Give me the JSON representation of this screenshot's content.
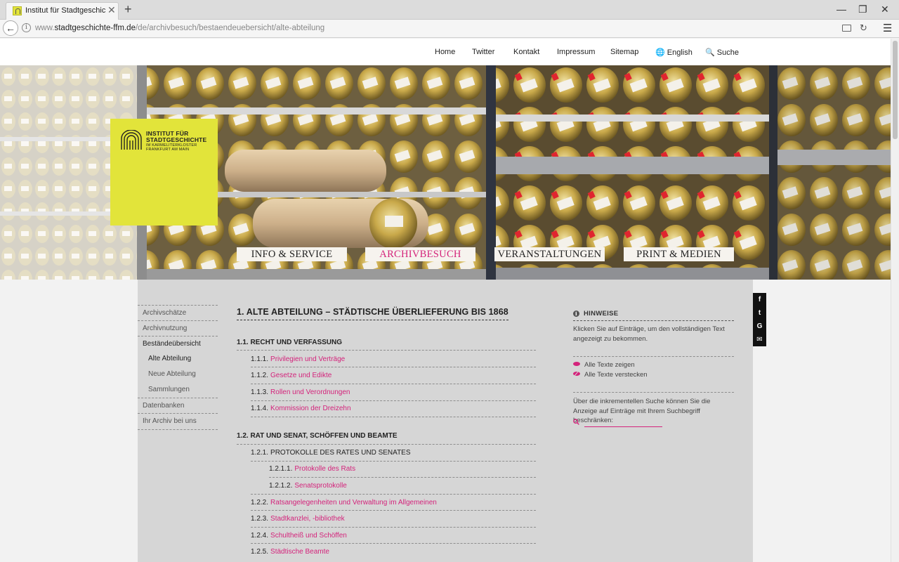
{
  "browser": {
    "tab_title": "Institut für Stadtgeschicht…",
    "tab_close": "✕",
    "new_tab": "+",
    "url_prefix": "www.",
    "url_domain": "stadtgeschichte-ffm.de",
    "url_path": "/de/archivbesuch/bestaendeuebersicht/alte-abteilung",
    "window_controls": [
      "—",
      "❐",
      "✕"
    ],
    "back_glyph": "←",
    "reload_glyph": "↻",
    "menu_glyph": "☰",
    "info_glyph": "i"
  },
  "topnav": {
    "items": [
      "Home",
      "Twitter",
      "Kontakt",
      "Impressum",
      "Sitemap",
      "🌐 English",
      "🔍 Suche"
    ]
  },
  "logo": {
    "line1": "INSTITUT FÜR",
    "line2": "STADTGESCHICHTE",
    "line3": "IM KARMELITERKLOSTER",
    "line4": "FRANKFURT AM MAIN"
  },
  "mainnav": {
    "items": [
      "INFO & SERVICE",
      "ARCHIVBESUCH",
      "VERANSTALTUNGEN",
      "PRINT & MEDIEN"
    ],
    "active_index": 1
  },
  "sidebar": {
    "items": [
      "Archivschätze",
      "Archivnutzung",
      "Beständeübersicht",
      "Alte Abteilung",
      "Neue Abteilung",
      "Sammlungen",
      "Datenbanken",
      "Ihr Archiv bei uns"
    ]
  },
  "main": {
    "title": "1. ALTE ABTEILUNG – STÄDTISCHE ÜBERLIEFERUNG BIS 1868",
    "section1": {
      "heading": "1.1. RECHT UND VERFASSUNG",
      "entries": [
        {
          "num": "1.1.1.",
          "label": "Privilegien und Verträge"
        },
        {
          "num": "1.1.2.",
          "label": "Gesetze und Edikte"
        },
        {
          "num": "1.1.3.",
          "label": "Rollen und Verordnungen"
        },
        {
          "num": "1.1.4.",
          "label": "Kommission der Dreizehn"
        }
      ]
    },
    "section2": {
      "heading": "1.2. RAT UND SENAT, SCHÖFFEN UND BEAMTE",
      "sub_heading_num": "1.2.1.",
      "sub_heading": "PROTOKOLLE DES RATES UND SENATES",
      "sub_entries": [
        {
          "num": "1.2.1.1.",
          "label": "Protokolle des Rats"
        },
        {
          "num": "1.2.1.2.",
          "label": "Senatsprotokolle"
        }
      ],
      "entries": [
        {
          "num": "1.2.2.",
          "label": "Ratsangelegenheiten und Verwaltung im Allgemeinen"
        },
        {
          "num": "1.2.3.",
          "label": "Stadtkanzlei, -bibliothek"
        },
        {
          "num": "1.2.4.",
          "label": "Schultheiß und Schöffen"
        },
        {
          "num": "1.2.5.",
          "label": "Städtische Beamte"
        }
      ]
    }
  },
  "hints": {
    "heading": "HINWEISE",
    "text": "Klicken Sie auf Einträge, um den vollständigen Text angezeigt zu bekommen.",
    "show_all": "Alle Texte zeigen",
    "hide_all": "Alle Texte verstecken",
    "search_desc": "Über die inkrementellen Suche können Sie die Anzeige auf Einträge mit Ihrem Suchbegriff beschränken:",
    "search_value": ""
  },
  "social": {
    "icons": [
      "f",
      "t",
      "G",
      "✉"
    ]
  },
  "colors": {
    "accent": "#d4237b",
    "logo": "#e2e43a",
    "content_bg": "#d6d6d6"
  }
}
